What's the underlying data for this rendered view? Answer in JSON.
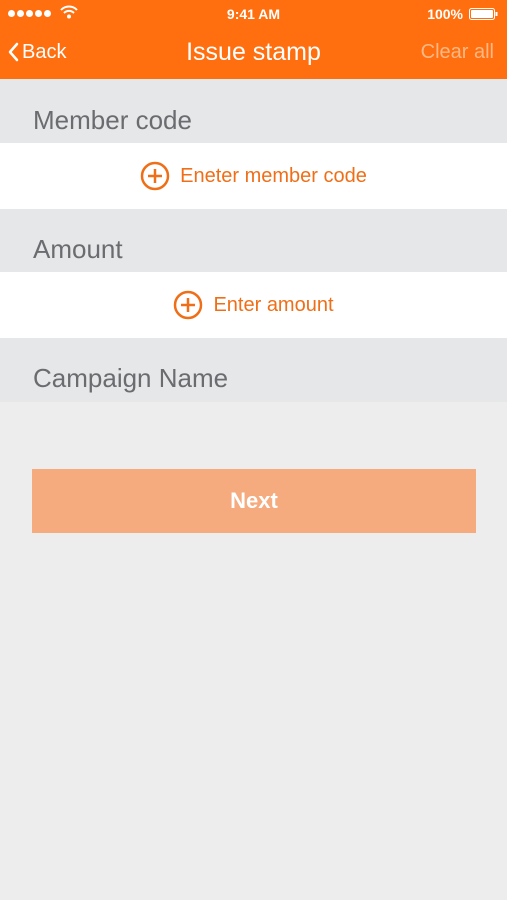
{
  "status_bar": {
    "time": "9:41 AM",
    "battery": "100%"
  },
  "nav": {
    "back_label": "Back",
    "title": "Issue stamp",
    "clear_label": "Clear all"
  },
  "sections": [
    {
      "label": "Member code",
      "action": "Eneter member code"
    },
    {
      "label": "Amount",
      "action": "Enter amount"
    },
    {
      "label": "Campaign Name"
    }
  ],
  "next_label": "Next",
  "colors": {
    "header": "#ff6f0f",
    "accent_text": "#ef6f18",
    "button": "#f5ab7d",
    "section_bg": "#e6e7e8",
    "page_bg": "#ededed"
  },
  "icons": [
    "signal-dots-icon",
    "wifi-icon",
    "battery-icon",
    "chevron-left-icon",
    "plus-circle-icon"
  ]
}
